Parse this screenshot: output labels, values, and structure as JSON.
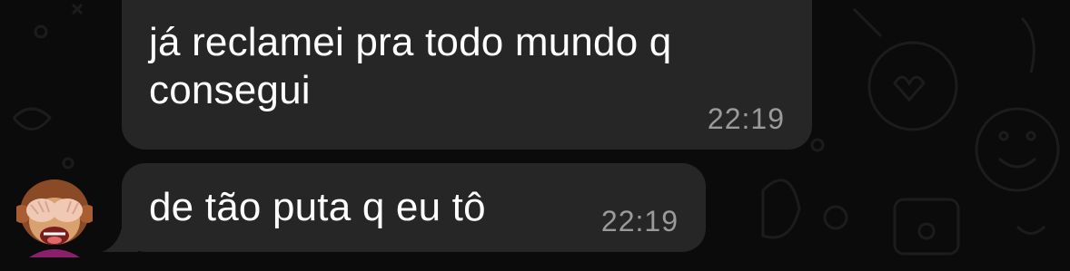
{
  "chat": {
    "messages": [
      {
        "text": "já reclamei pra todo mundo q\nconsegui",
        "time": "22:19"
      },
      {
        "text": "de tão puta q eu tô",
        "time": "22:19"
      }
    ]
  },
  "sender": {
    "avatar_icon": "see-no-evil-monkey-memoji-icon"
  },
  "colors": {
    "background": "#0b0b0b",
    "bubble": "#262626",
    "text": "#ffffff",
    "timestamp": "#9a9a9a"
  }
}
